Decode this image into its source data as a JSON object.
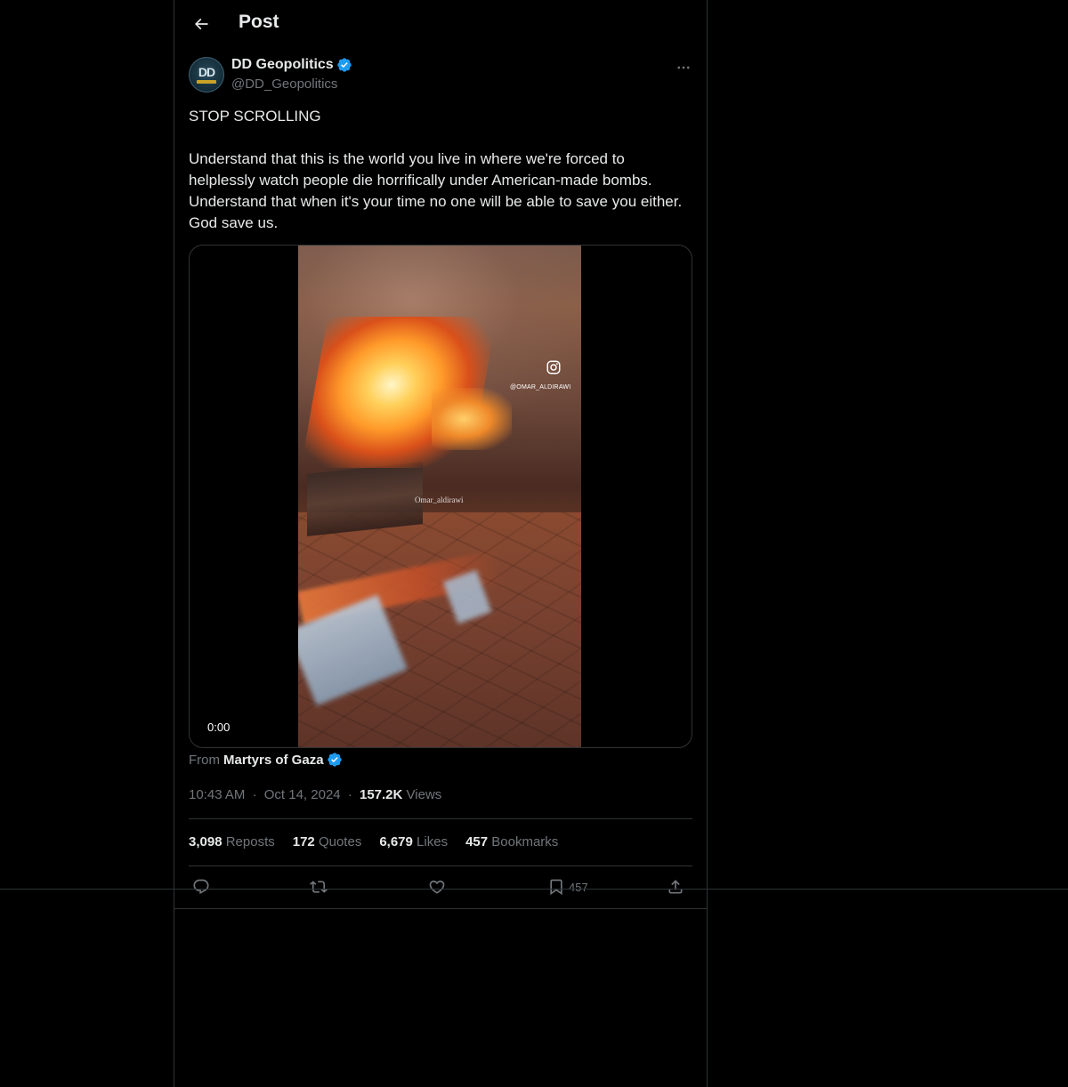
{
  "header": {
    "title": "Post",
    "back_icon": "arrow-left-icon"
  },
  "author": {
    "display_name": "DD Geopolitics",
    "handle": "@DD_Geopolitics",
    "avatar_text": "DD",
    "verified_color": "#1d9bf0"
  },
  "post": {
    "text": "STOP SCROLLING\n\nUnderstand that this is the world you live in where we're forced to helplessly watch people die horrifically under American-made bombs. Understand that when it's your time no one will be able to save you either. God save us."
  },
  "media": {
    "video_time": "0:00",
    "instagram_handle": "@OMAR_ALDIRAWI",
    "watermark": "Omar_aldirawi"
  },
  "source": {
    "prefix": "From",
    "name": "Martyrs of Gaza"
  },
  "meta": {
    "time": "10:43 AM",
    "separator": "·",
    "date": "Oct 14, 2024",
    "views_count": "157.2K",
    "views_label": "Views"
  },
  "stats": {
    "reposts_count": "3,098",
    "reposts_label": "Reposts",
    "quotes_count": "172",
    "quotes_label": "Quotes",
    "likes_count": "6,679",
    "likes_label": "Likes",
    "bookmarks_count": "457",
    "bookmarks_label": "Bookmarks"
  },
  "actions": {
    "reply_icon": "reply-icon",
    "repost_icon": "repost-icon",
    "like_icon": "like-icon",
    "bookmark_icon": "bookmark-icon",
    "bookmark_count": "457",
    "share_icon": "share-icon"
  },
  "colors": {
    "background": "#000000",
    "text": "#e7e9ea",
    "secondary": "#71767b",
    "border": "#2f3336",
    "accent": "#1d9bf0"
  }
}
